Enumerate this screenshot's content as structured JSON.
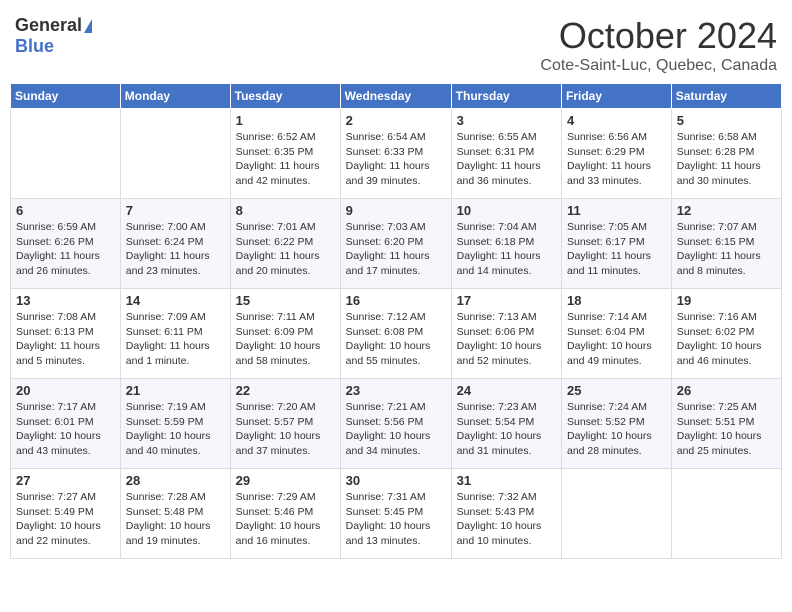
{
  "logo": {
    "general": "General",
    "blue": "Blue"
  },
  "title": "October 2024",
  "subtitle": "Cote-Saint-Luc, Quebec, Canada",
  "days_of_week": [
    "Sunday",
    "Monday",
    "Tuesday",
    "Wednesday",
    "Thursday",
    "Friday",
    "Saturday"
  ],
  "weeks": [
    [
      {
        "day": "",
        "info": ""
      },
      {
        "day": "",
        "info": ""
      },
      {
        "day": "1",
        "info": "Sunrise: 6:52 AM\nSunset: 6:35 PM\nDaylight: 11 hours and 42 minutes."
      },
      {
        "day": "2",
        "info": "Sunrise: 6:54 AM\nSunset: 6:33 PM\nDaylight: 11 hours and 39 minutes."
      },
      {
        "day": "3",
        "info": "Sunrise: 6:55 AM\nSunset: 6:31 PM\nDaylight: 11 hours and 36 minutes."
      },
      {
        "day": "4",
        "info": "Sunrise: 6:56 AM\nSunset: 6:29 PM\nDaylight: 11 hours and 33 minutes."
      },
      {
        "day": "5",
        "info": "Sunrise: 6:58 AM\nSunset: 6:28 PM\nDaylight: 11 hours and 30 minutes."
      }
    ],
    [
      {
        "day": "6",
        "info": "Sunrise: 6:59 AM\nSunset: 6:26 PM\nDaylight: 11 hours and 26 minutes."
      },
      {
        "day": "7",
        "info": "Sunrise: 7:00 AM\nSunset: 6:24 PM\nDaylight: 11 hours and 23 minutes."
      },
      {
        "day": "8",
        "info": "Sunrise: 7:01 AM\nSunset: 6:22 PM\nDaylight: 11 hours and 20 minutes."
      },
      {
        "day": "9",
        "info": "Sunrise: 7:03 AM\nSunset: 6:20 PM\nDaylight: 11 hours and 17 minutes."
      },
      {
        "day": "10",
        "info": "Sunrise: 7:04 AM\nSunset: 6:18 PM\nDaylight: 11 hours and 14 minutes."
      },
      {
        "day": "11",
        "info": "Sunrise: 7:05 AM\nSunset: 6:17 PM\nDaylight: 11 hours and 11 minutes."
      },
      {
        "day": "12",
        "info": "Sunrise: 7:07 AM\nSunset: 6:15 PM\nDaylight: 11 hours and 8 minutes."
      }
    ],
    [
      {
        "day": "13",
        "info": "Sunrise: 7:08 AM\nSunset: 6:13 PM\nDaylight: 11 hours and 5 minutes."
      },
      {
        "day": "14",
        "info": "Sunrise: 7:09 AM\nSunset: 6:11 PM\nDaylight: 11 hours and 1 minute."
      },
      {
        "day": "15",
        "info": "Sunrise: 7:11 AM\nSunset: 6:09 PM\nDaylight: 10 hours and 58 minutes."
      },
      {
        "day": "16",
        "info": "Sunrise: 7:12 AM\nSunset: 6:08 PM\nDaylight: 10 hours and 55 minutes."
      },
      {
        "day": "17",
        "info": "Sunrise: 7:13 AM\nSunset: 6:06 PM\nDaylight: 10 hours and 52 minutes."
      },
      {
        "day": "18",
        "info": "Sunrise: 7:14 AM\nSunset: 6:04 PM\nDaylight: 10 hours and 49 minutes."
      },
      {
        "day": "19",
        "info": "Sunrise: 7:16 AM\nSunset: 6:02 PM\nDaylight: 10 hours and 46 minutes."
      }
    ],
    [
      {
        "day": "20",
        "info": "Sunrise: 7:17 AM\nSunset: 6:01 PM\nDaylight: 10 hours and 43 minutes."
      },
      {
        "day": "21",
        "info": "Sunrise: 7:19 AM\nSunset: 5:59 PM\nDaylight: 10 hours and 40 minutes."
      },
      {
        "day": "22",
        "info": "Sunrise: 7:20 AM\nSunset: 5:57 PM\nDaylight: 10 hours and 37 minutes."
      },
      {
        "day": "23",
        "info": "Sunrise: 7:21 AM\nSunset: 5:56 PM\nDaylight: 10 hours and 34 minutes."
      },
      {
        "day": "24",
        "info": "Sunrise: 7:23 AM\nSunset: 5:54 PM\nDaylight: 10 hours and 31 minutes."
      },
      {
        "day": "25",
        "info": "Sunrise: 7:24 AM\nSunset: 5:52 PM\nDaylight: 10 hours and 28 minutes."
      },
      {
        "day": "26",
        "info": "Sunrise: 7:25 AM\nSunset: 5:51 PM\nDaylight: 10 hours and 25 minutes."
      }
    ],
    [
      {
        "day": "27",
        "info": "Sunrise: 7:27 AM\nSunset: 5:49 PM\nDaylight: 10 hours and 22 minutes."
      },
      {
        "day": "28",
        "info": "Sunrise: 7:28 AM\nSunset: 5:48 PM\nDaylight: 10 hours and 19 minutes."
      },
      {
        "day": "29",
        "info": "Sunrise: 7:29 AM\nSunset: 5:46 PM\nDaylight: 10 hours and 16 minutes."
      },
      {
        "day": "30",
        "info": "Sunrise: 7:31 AM\nSunset: 5:45 PM\nDaylight: 10 hours and 13 minutes."
      },
      {
        "day": "31",
        "info": "Sunrise: 7:32 AM\nSunset: 5:43 PM\nDaylight: 10 hours and 10 minutes."
      },
      {
        "day": "",
        "info": ""
      },
      {
        "day": "",
        "info": ""
      }
    ]
  ]
}
